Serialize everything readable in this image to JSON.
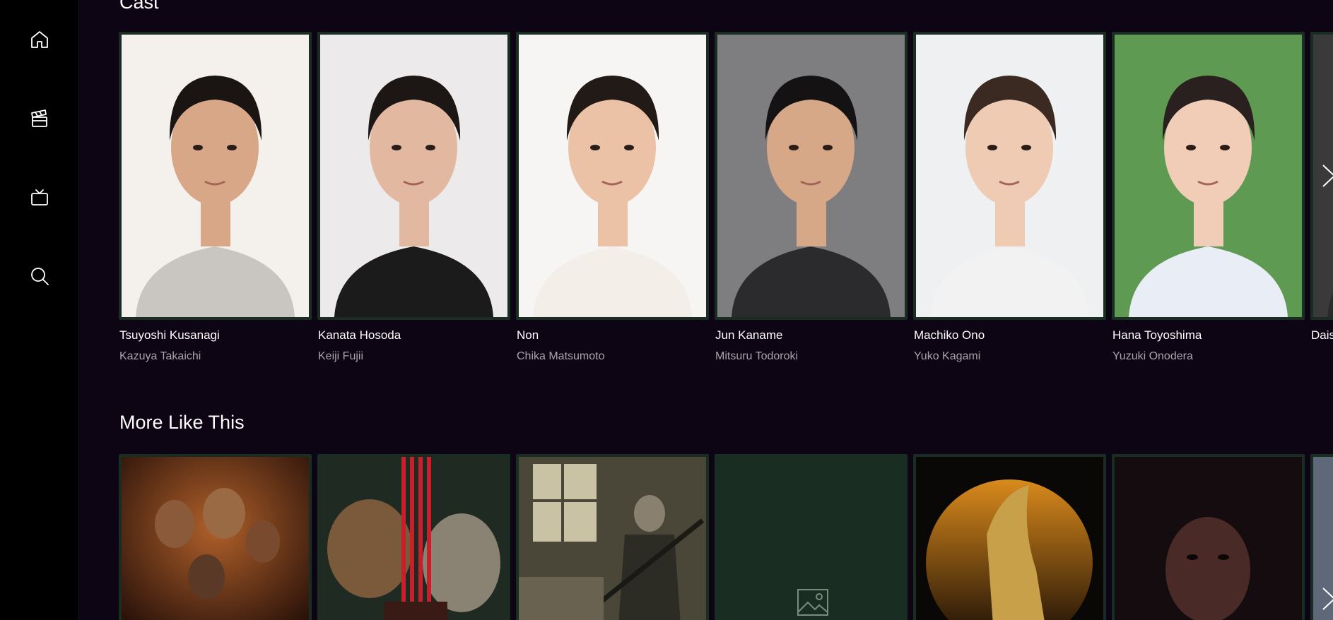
{
  "sidebar": {
    "items": [
      {
        "icon": "home-icon"
      },
      {
        "icon": "movies-icon"
      },
      {
        "icon": "tv-icon"
      },
      {
        "icon": "search-icon"
      }
    ]
  },
  "cast": {
    "title": "Cast",
    "members": [
      {
        "name": "Tsuyoshi Kusanagi",
        "role": "Kazuya Takaichi",
        "bg": "#f4f1ec",
        "skin": "#d8a788",
        "hair": "#1a1512",
        "cloth": "#c9c6c1"
      },
      {
        "name": "Kanata Hosoda",
        "role": "Keiji Fujii",
        "bg": "#eceaea",
        "skin": "#e2b9a0",
        "hair": "#1c1714",
        "cloth": "#1b1b1b"
      },
      {
        "name": "Non",
        "role": "Chika Matsumoto",
        "bg": "#f6f5f3",
        "skin": "#ecc2a6",
        "hair": "#221a16",
        "cloth": "#f3efe8"
      },
      {
        "name": "Jun Kaname",
        "role": "Mitsuru Todoroki",
        "bg": "#7e7e80",
        "skin": "#d6a887",
        "hair": "#141212",
        "cloth": "#2b2b2d"
      },
      {
        "name": "Machiko Ono",
        "role": "Yuko Kagami",
        "bg": "#eef0f2",
        "skin": "#f0cbb4",
        "hair": "#3a2a22",
        "cloth": "#f2f2f2"
      },
      {
        "name": "Hana Toyoshima",
        "role": "Yuzuki Onodera",
        "bg": "#5f9a52",
        "skin": "#f1cdb8",
        "hair": "#2a2020",
        "cloth": "#e9eef6"
      },
      {
        "name": "Dais",
        "role": "",
        "bg": "#3a3a3a",
        "skin": "#c79e82",
        "hair": "#151212",
        "cloth": "#2a2a2a"
      }
    ]
  },
  "more_like_this": {
    "title": "More Like This",
    "posters": [
      {
        "label": "poster-1",
        "tone": "#5a2a14"
      },
      {
        "label": "poster-2",
        "tone": "#1f2a22"
      },
      {
        "label": "poster-3",
        "tone": "#6b6452"
      },
      {
        "label": "poster-4",
        "tone": "#1a2d22"
      },
      {
        "label": "poster-5",
        "tone": "#0a0806"
      },
      {
        "label": "poster-6",
        "tone": "#150c10"
      },
      {
        "label": "poster-7",
        "tone": "#5e6878"
      }
    ]
  },
  "colors": {
    "background": "#0d0414",
    "sidebar": "#000000",
    "card_border": "#1a2d22",
    "secondary_text": "#a9a4ad"
  }
}
